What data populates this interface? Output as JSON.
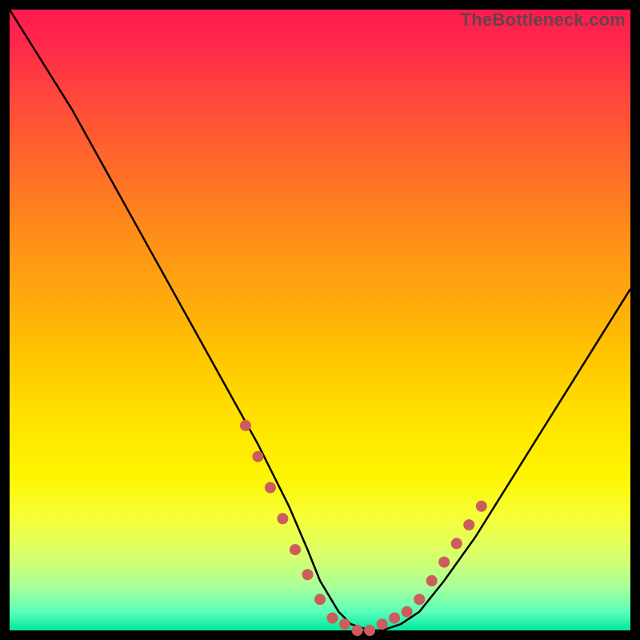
{
  "watermark": "TheBottleneck.com",
  "chart_data": {
    "type": "line",
    "title": "",
    "xlabel": "",
    "ylabel": "",
    "xlim": [
      0,
      100
    ],
    "ylim": [
      0,
      100
    ],
    "grid": false,
    "series": [
      {
        "name": "bottleneck-curve",
        "x": [
          0,
          5,
          10,
          15,
          20,
          25,
          30,
          35,
          40,
          45,
          48,
          50,
          53,
          55,
          58,
          60,
          63,
          66,
          70,
          75,
          80,
          85,
          90,
          95,
          100
        ],
        "values": [
          100,
          92,
          84,
          75,
          66,
          57,
          48,
          39,
          30,
          20,
          13,
          8,
          3,
          1,
          0,
          0,
          1,
          3,
          8,
          15,
          23,
          31,
          39,
          47,
          55
        ]
      }
    ],
    "markers": {
      "name": "highlight-points",
      "x": [
        38,
        40,
        42,
        44,
        46,
        48,
        50,
        52,
        54,
        56,
        58,
        60,
        62,
        64,
        66,
        68,
        70,
        72,
        74,
        76
      ],
      "values": [
        33,
        28,
        23,
        18,
        13,
        9,
        5,
        2,
        1,
        0,
        0,
        1,
        2,
        3,
        5,
        8,
        11,
        14,
        17,
        20
      ]
    },
    "colors": {
      "curve": "#000000",
      "marker": "#cd5c5c"
    }
  }
}
